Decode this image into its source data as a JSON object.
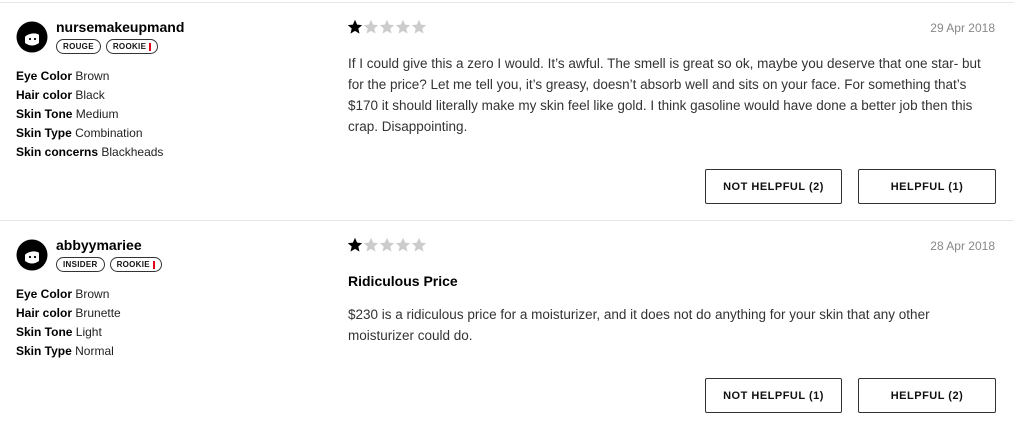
{
  "reviews": [
    {
      "username": "nursemakeupmand",
      "badges": [
        "ROUGE",
        "ROOKIE"
      ],
      "rating": 1,
      "max_rating": 5,
      "date": "29 Apr 2018",
      "title": "",
      "text": "If I could give this a zero I would. It’s awful. The smell is great so ok, maybe you deserve that one star- but for the price? Let me tell you, it’s greasy, doesn’t absorb well and sits on your face. For something that’s $170 it should literally make my skin feel like gold. I think gasoline would have done a better job then this crap. Disappointing.",
      "attributes": [
        {
          "label": "Eye Color",
          "value": "Brown"
        },
        {
          "label": "Hair color",
          "value": "Black"
        },
        {
          "label": "Skin Tone",
          "value": "Medium"
        },
        {
          "label": "Skin Type",
          "value": "Combination"
        },
        {
          "label": "Skin concerns",
          "value": "Blackheads"
        }
      ],
      "not_helpful_label": "NOT HELPFUL (2)",
      "helpful_label": "HELPFUL (1)"
    },
    {
      "username": "abbyymariee",
      "badges": [
        "INSIDER",
        "ROOKIE"
      ],
      "rating": 1,
      "max_rating": 5,
      "date": "28 Apr 2018",
      "title": "Ridiculous Price",
      "text": "$230 is a ridiculous price for a moisturizer, and it does not do anything for your skin that any other moisturizer could do.",
      "attributes": [
        {
          "label": "Eye Color",
          "value": "Brown"
        },
        {
          "label": "Hair color",
          "value": "Brunette"
        },
        {
          "label": "Skin Tone",
          "value": "Light"
        },
        {
          "label": "Skin Type",
          "value": "Normal"
        }
      ],
      "not_helpful_label": "NOT HELPFUL (1)",
      "helpful_label": "HELPFUL (2)"
    }
  ],
  "colors": {
    "star_filled": "#000000",
    "star_empty": "#cccccc",
    "rookie_accent": "#e0001b"
  },
  "icons": {
    "avatar": "avatar-icon",
    "star": "star-icon"
  }
}
